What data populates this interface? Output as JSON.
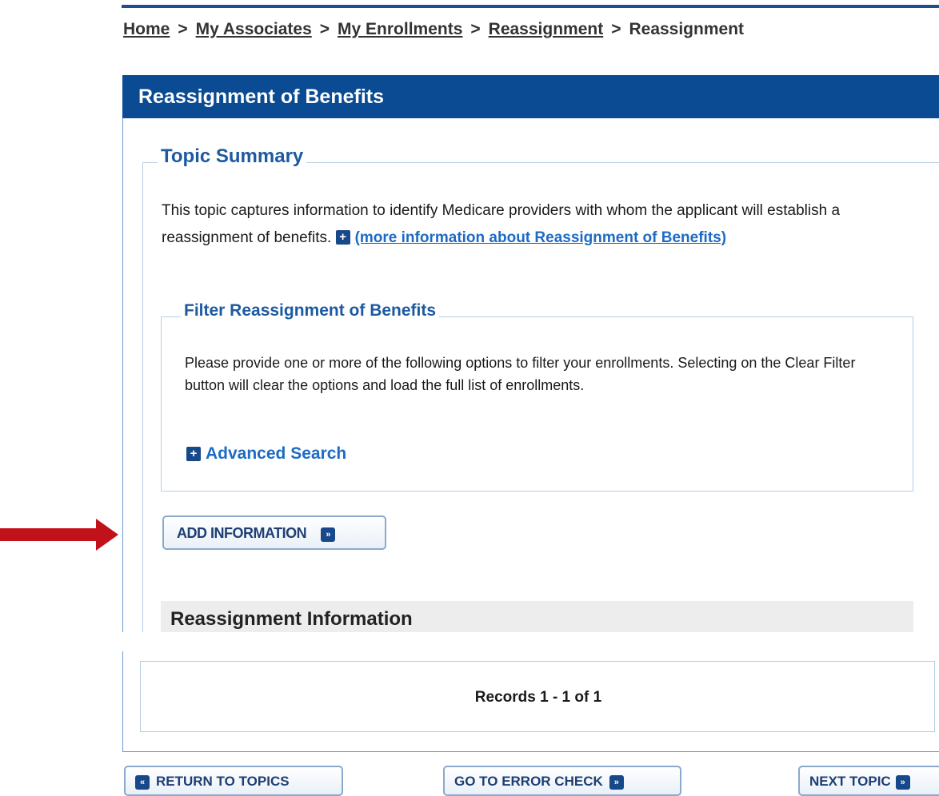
{
  "breadcrumb": {
    "items": [
      "Home",
      "My Associates",
      "My Enrollments",
      "Reassignment"
    ],
    "current": "Reassignment",
    "separator": ">"
  },
  "panel": {
    "title": "Reassignment of Benefits"
  },
  "topic_summary": {
    "legend": "Topic Summary",
    "text": "This topic captures information to identify Medicare providers with whom the applicant will establish a reassignment of benefits.",
    "more_info_link": "(more information about Reassignment of Benefits)"
  },
  "filter": {
    "legend": "Filter Reassignment of Benefits",
    "text": "Please provide one or more of the following options to filter your enrollments. Selecting on the Clear Filter button will clear the options and load the full list of enrollments.",
    "advanced_search_label": "Advanced Search"
  },
  "add_button_label": "ADD INFORMATION",
  "reassignment_section": {
    "title": "Reassignment Information"
  },
  "records": {
    "text": "Records 1 - 1 of 1"
  },
  "footer": {
    "return_label": "RETURN TO TOPICS",
    "error_check_label": "GO TO ERROR CHECK",
    "next_label": "NEXT TOPIC"
  },
  "colors": {
    "header_bg": "#0a4b93",
    "link": "#1d6bc4",
    "annotation_arrow": "#c1121a"
  },
  "icons": [
    "plus-icon",
    "arrow-right-icon",
    "arrow-left-icon",
    "annotation-arrow"
  ]
}
